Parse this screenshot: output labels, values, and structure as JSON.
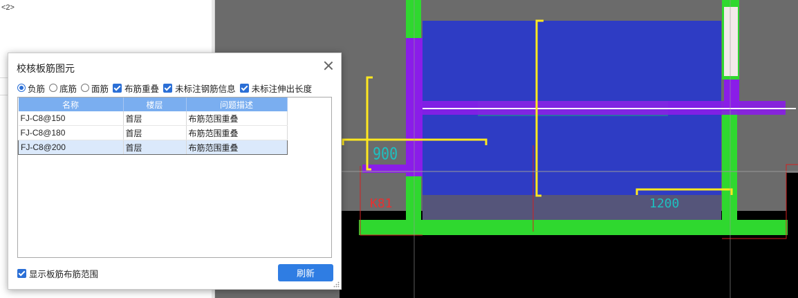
{
  "left_panel": {
    "top_text": "<2>"
  },
  "dialog": {
    "title": "校核板筋图元",
    "radios": [
      {
        "label": "负筋",
        "selected": true
      },
      {
        "label": "底筋",
        "selected": false
      },
      {
        "label": "面筋",
        "selected": false
      }
    ],
    "checkboxes": [
      {
        "label": "布筋重叠",
        "checked": true
      },
      {
        "label": "未标注钢筋信息",
        "checked": true
      },
      {
        "label": "未标注伸出长度",
        "checked": true
      }
    ],
    "table": {
      "headers": [
        "名称",
        "楼层",
        "问题描述"
      ],
      "rows": [
        [
          "FJ-C8@150",
          "首层",
          "布筋范围重叠"
        ],
        [
          "FJ-C8@180",
          "首层",
          "布筋范围重叠"
        ],
        [
          "FJ-C8@200",
          "首层",
          "布筋范围重叠"
        ]
      ],
      "selected_row": 2
    },
    "show_range": {
      "label": "显示板筋布筋范围",
      "checked": true
    },
    "refresh_label": "刷新"
  },
  "canvas_labels": {
    "dim_900": "900",
    "dim_1200": "1200",
    "k_label": "K81"
  },
  "colors": {
    "canvas_bg": "#6b6b6b",
    "slab_blue": "#2e3cc4",
    "beam_purple": "#8a1de8",
    "wall_green": "#2fd82f",
    "rebar_yellow": "#ffe81f",
    "accent_blue": "#2f7de3"
  }
}
